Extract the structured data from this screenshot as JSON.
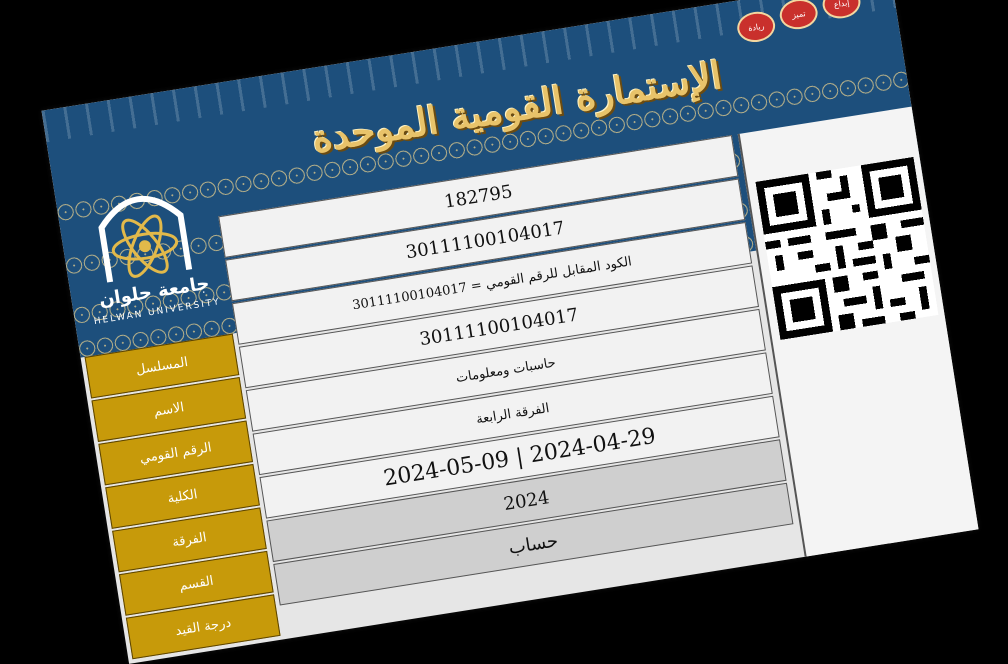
{
  "card": {
    "title": "الإستمارة القومية الموحدة",
    "university_ar": "جامعة حلوان",
    "university_en": "HELWAN UNIVERSITY",
    "badges": [
      "ريادة",
      "تميز",
      "إبداع"
    ]
  },
  "labels": [
    "المسلسل",
    "الاسم",
    "الرقم القومي",
    "الكلية",
    "الفرقة",
    "القسم",
    "درجة القيد"
  ],
  "values": [
    {
      "text": "182795",
      "style": "normal"
    },
    {
      "text": "30111100104017",
      "style": "normal"
    },
    {
      "text": "30111100104017 = الكود المقابل للرقم القومي",
      "style": "small"
    },
    {
      "text": "30111100104017",
      "style": "normal"
    },
    {
      "text": "حاسبات ومعلومات",
      "style": "small"
    },
    {
      "text": "الفرقة الرابعة",
      "style": "small"
    },
    {
      "text": "2024-05-09 | 2024-04-29",
      "style": "big"
    },
    {
      "text": "2024",
      "style": "grey"
    },
    {
      "text": "حساب",
      "style": "grey"
    }
  ]
}
